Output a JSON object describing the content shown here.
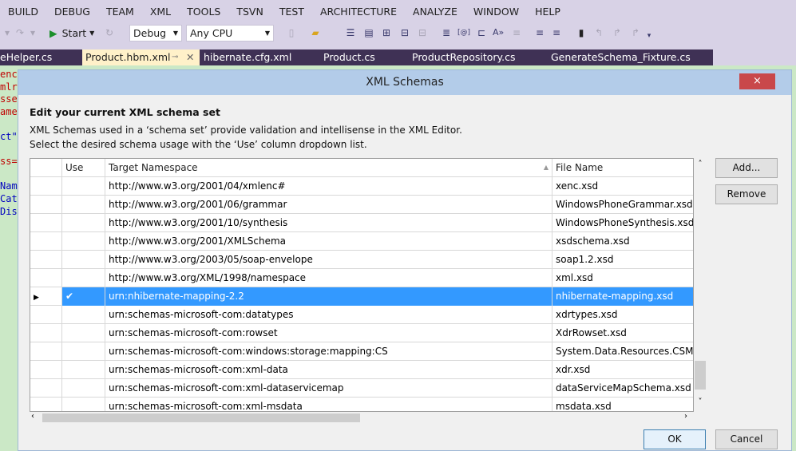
{
  "menu": [
    "BUILD",
    "DEBUG",
    "TEAM",
    "XML",
    "TOOLS",
    "TSVN",
    "TEST",
    "ARCHITECTURE",
    "ANALYZE",
    "WINDOW",
    "HELP"
  ],
  "toolbar": {
    "start_label": "Start",
    "config": "Debug",
    "platform": "Any CPU"
  },
  "tabs": [
    {
      "label": "eHelper.cs"
    },
    {
      "label": "Product.hbm.xml",
      "active": true
    },
    {
      "label": "hibernate.cfg.xml"
    },
    {
      "label": "Product.cs"
    },
    {
      "label": "ProductRepository.cs"
    },
    {
      "label": "GenerateSchema_Fixture.cs"
    }
  ],
  "editor": {
    "code_fragments": [
      {
        "text": "enc",
        "color": "#c00000"
      },
      {
        "text": "mlr",
        "color": "#c00000"
      },
      {
        "text": "sse",
        "color": "#c00000"
      },
      {
        "text": "ame",
        "color": "#c00000"
      },
      {
        "text": "",
        "color": "#000"
      },
      {
        "text": "ct\"",
        "color": "#0000c0"
      },
      {
        "text": "",
        "color": "#000"
      },
      {
        "text": "ss=",
        "color": "#c00000"
      },
      {
        "text": "",
        "color": "#000"
      },
      {
        "text": "Nam",
        "color": "#0000c0"
      },
      {
        "text": "Cat",
        "color": "#0000c0"
      },
      {
        "text": "Dis",
        "color": "#0000c0"
      }
    ]
  },
  "dialog": {
    "title": "XML Schemas",
    "help": "?",
    "close": "×",
    "heading": "Edit your current XML schema set",
    "desc1": "XML Schemas used in a ‘schema set’ provide validation and intellisense in the XML Editor.",
    "desc2": "Select the desired schema usage with the ‘Use’ column dropdown list.",
    "columns": [
      "",
      "Use",
      "Target Namespace",
      "File Name"
    ],
    "rows": [
      {
        "use": "",
        "ns": "http://www.w3.org/2001/04/xmlenc#",
        "file": "xenc.xsd"
      },
      {
        "use": "",
        "ns": "http://www.w3.org/2001/06/grammar",
        "file": "WindowsPhoneGrammar.xsd"
      },
      {
        "use": "",
        "ns": "http://www.w3.org/2001/10/synthesis",
        "file": "WindowsPhoneSynthesis.xsd"
      },
      {
        "use": "",
        "ns": "http://www.w3.org/2001/XMLSchema",
        "file": "xsdschema.xsd"
      },
      {
        "use": "",
        "ns": "http://www.w3.org/2003/05/soap-envelope",
        "file": "soap1.2.xsd"
      },
      {
        "use": "",
        "ns": "http://www.w3.org/XML/1998/namespace",
        "file": "xml.xsd"
      },
      {
        "use": "✔",
        "ns": "urn:nhibernate-mapping-2.2",
        "file": "nhibernate-mapping.xsd",
        "selected": true
      },
      {
        "use": "",
        "ns": "urn:schemas-microsoft-com:datatypes",
        "file": "xdrtypes.xsd"
      },
      {
        "use": "",
        "ns": "urn:schemas-microsoft-com:rowset",
        "file": "XdrRowset.xsd"
      },
      {
        "use": "",
        "ns": "urn:schemas-microsoft-com:windows:storage:mapping:CS",
        "file": "System.Data.Resources.CSMSL"
      },
      {
        "use": "",
        "ns": "urn:schemas-microsoft-com:xml-data",
        "file": "xdr.xsd"
      },
      {
        "use": "",
        "ns": "urn:schemas-microsoft-com:xml-dataservicemap",
        "file": "dataServiceMapSchema.xsd"
      },
      {
        "use": "",
        "ns": "urn:schemas-microsoft-com:xml-msdata",
        "file": "msdata.xsd"
      }
    ],
    "buttons": {
      "add": "Add...",
      "remove": "Remove",
      "ok": "OK",
      "cancel": "Cancel"
    }
  },
  "colors": {
    "selection": "#3399ff",
    "title_bar": "#b3cce9",
    "close": "#c9484a",
    "tab_bar": "#3f3155",
    "active_tab": "#fff1c9"
  }
}
